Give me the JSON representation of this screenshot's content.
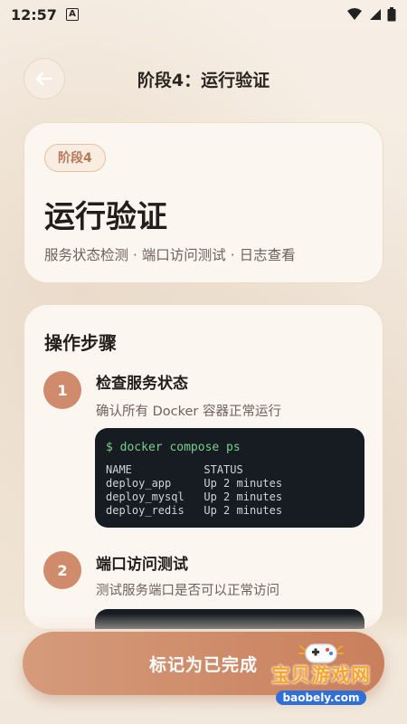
{
  "status_bar": {
    "time": "12:57",
    "notification_icon": "A",
    "icons": [
      "wifi-icon",
      "signal-icon",
      "battery-icon"
    ]
  },
  "header": {
    "title": "阶段4：运行验证",
    "back_icon": "arrow-left-icon"
  },
  "stage": {
    "badge": "阶段4",
    "title": "运行验证",
    "subtitle": "服务状态检测 · 端口访问测试 · 日志查看"
  },
  "steps_section": {
    "title": "操作步骤",
    "steps": [
      {
        "num": "1",
        "title": "检查服务状态",
        "desc": "确认所有 Docker 容器正常运行",
        "command": "$ docker compose ps",
        "output": "NAME           STATUS\ndeploy_app     Up 2 minutes\ndeploy_mysql   Up 2 minutes\ndeploy_redis   Up 2 minutes"
      },
      {
        "num": "2",
        "title": "端口访问测试",
        "desc": "测试服务端口是否可以正常访问"
      }
    ]
  },
  "action": {
    "complete_label": "标记为已完成"
  },
  "watermark": {
    "text": "宝贝游戏网",
    "url": "baobely.com"
  },
  "colors": {
    "accent": "#d08b6c",
    "background": "#f3e9dd",
    "terminal_bg": "#171c22",
    "command_green": "#7ad08a"
  }
}
